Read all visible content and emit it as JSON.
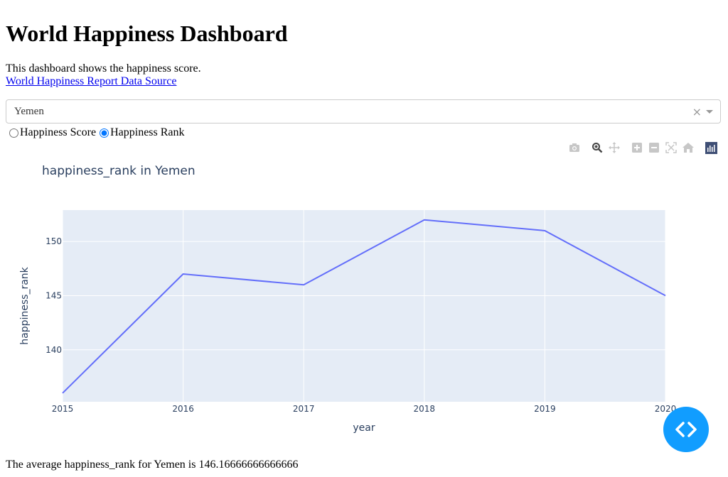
{
  "page": {
    "title": "World Happiness Dashboard",
    "description": "This dashboard shows the happiness score.",
    "link_text": "World Happiness Report Data Source"
  },
  "country_dropdown": {
    "selected": "Yemen",
    "clear_glyph": "×"
  },
  "metric_radio": {
    "options": [
      "Happiness Score",
      "Happiness Rank"
    ],
    "selected": "Happiness Rank"
  },
  "modebar": {
    "icons": [
      "camera-icon",
      "zoom-icon",
      "pan-icon",
      "zoom-in-icon",
      "zoom-out-icon",
      "autoscale-icon",
      "reset-axes-icon",
      "plotly-logo-icon"
    ]
  },
  "chart_data": {
    "type": "line",
    "title": "happiness_rank in Yemen",
    "xlabel": "year",
    "ylabel": "happiness_rank",
    "x": [
      2015,
      2016,
      2017,
      2018,
      2019,
      2020
    ],
    "series": [
      {
        "values": [
          136,
          147,
          146,
          152,
          151,
          145
        ],
        "color": "#636efa"
      }
    ],
    "xticks": [
      "2015",
      "2016",
      "2017",
      "2018",
      "2019",
      "2020"
    ],
    "yticks": [
      "140",
      "145",
      "150"
    ],
    "ytick_values": [
      140,
      145,
      150
    ],
    "xlim": [
      2015,
      2020
    ],
    "ylim": [
      135.2,
      152.9
    ],
    "plot_bg": "#e5ecf6",
    "grid": true
  },
  "footer": {
    "average_text": "The average happiness_rank for Yemen is 146.16666666666666"
  },
  "colors": {
    "link": "#0000ee",
    "fab": "#119dff",
    "line": "#636efa"
  }
}
